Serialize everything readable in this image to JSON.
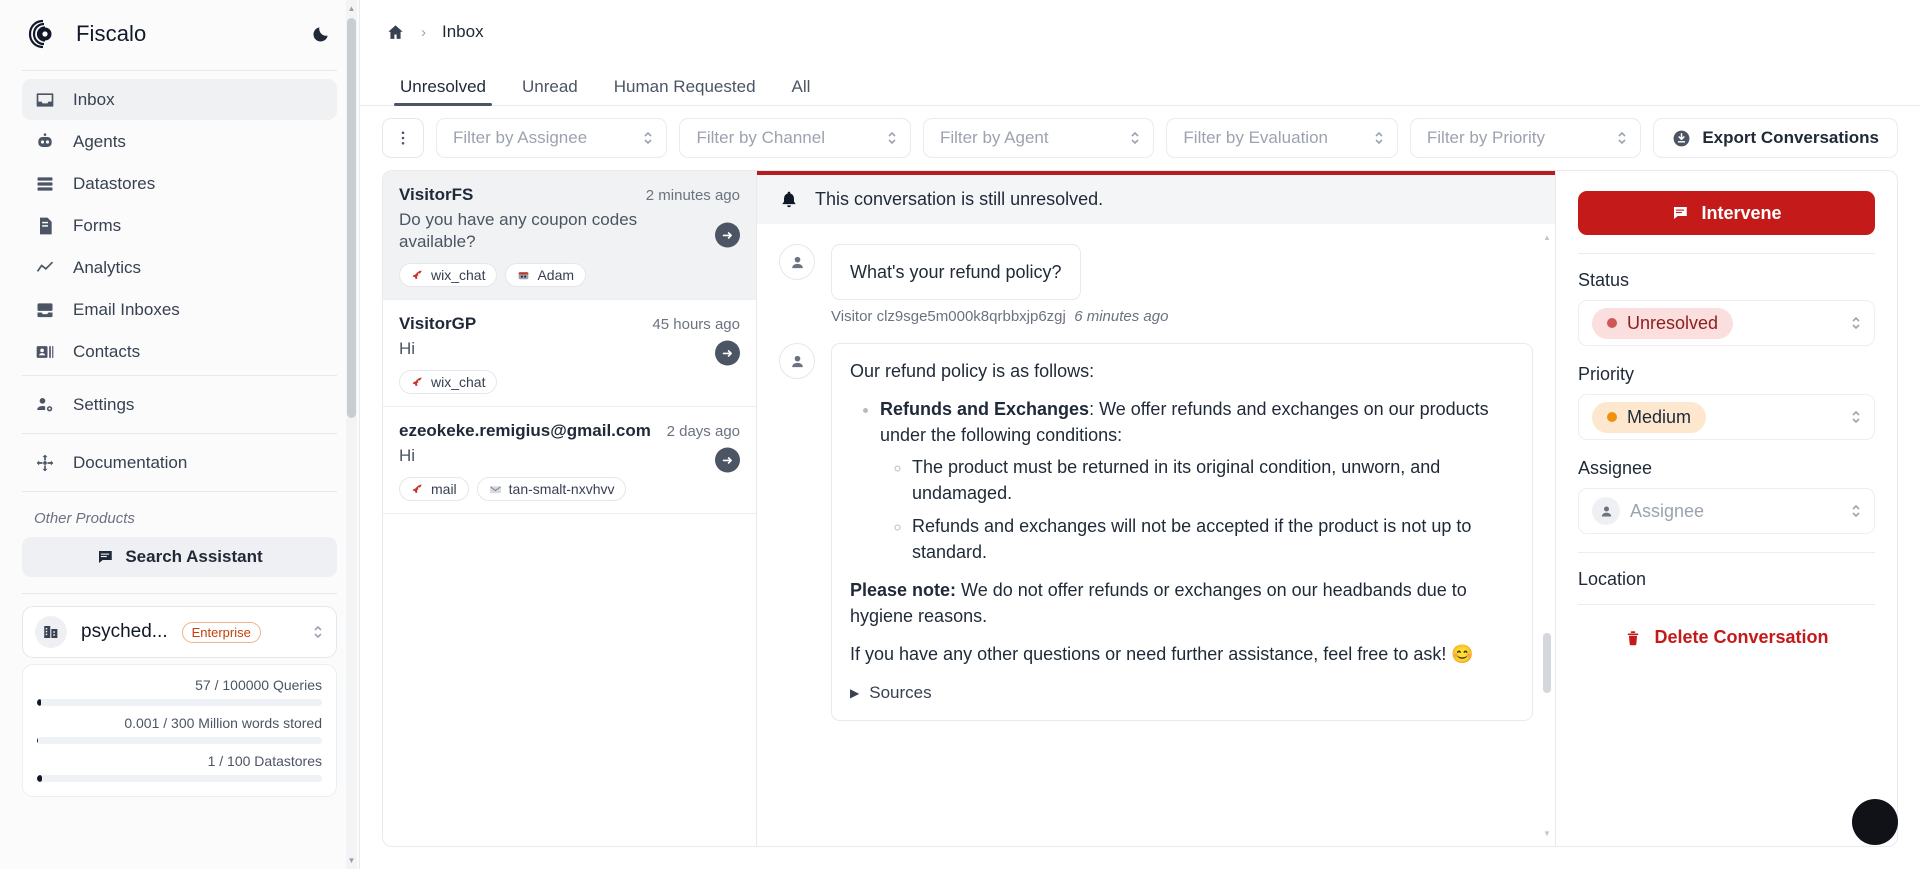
{
  "brand": {
    "name": "Fiscalo",
    "logo_icon": "fiscalo-logo-icon",
    "darkmode_icon": "moon-icon"
  },
  "sidebar": {
    "nav": [
      {
        "label": "Inbox",
        "icon": "inbox-icon",
        "active": true
      },
      {
        "label": "Agents",
        "icon": "robot-icon",
        "active": false
      },
      {
        "label": "Datastores",
        "icon": "database-icon",
        "active": false
      },
      {
        "label": "Forms",
        "icon": "document-icon",
        "active": false
      },
      {
        "label": "Analytics",
        "icon": "chart-line-icon",
        "active": false
      },
      {
        "label": "Email Inboxes",
        "icon": "email-inbox-icon",
        "active": false
      },
      {
        "label": "Contacts",
        "icon": "contact-card-icon",
        "active": false
      }
    ],
    "settings": {
      "label": "Settings",
      "icon": "user-settings-icon"
    },
    "documentation": {
      "label": "Documentation",
      "icon": "move-icon"
    },
    "other_products_title": "Other Products",
    "search_assistant": {
      "label": "Search Assistant",
      "icon": "chat-icon"
    },
    "org": {
      "name": "psyched...",
      "plan_badge": "Enterprise",
      "icon": "building-icon"
    },
    "usage": [
      {
        "label": "57 / 100000 Queries",
        "percent": 0.06
      },
      {
        "label": "0.001 / 300 Million words stored",
        "percent": 0.0
      },
      {
        "label": "1 / 100 Datastores",
        "percent": 1
      }
    ]
  },
  "breadcrumb": {
    "home_icon": "home-icon",
    "separator": "›",
    "current": "Inbox"
  },
  "tabs": [
    {
      "label": "Unresolved",
      "active": true
    },
    {
      "label": "Unread",
      "active": false
    },
    {
      "label": "Human Requested",
      "active": false
    },
    {
      "label": "All",
      "active": false
    }
  ],
  "filters": {
    "kebab_icon": "more-vertical-icon",
    "selects": [
      {
        "placeholder": "Filter by Assignee"
      },
      {
        "placeholder": "Filter by Channel"
      },
      {
        "placeholder": "Filter by Agent"
      },
      {
        "placeholder": "Filter by Evaluation"
      },
      {
        "placeholder": "Filter by Priority"
      }
    ],
    "export": {
      "label": "Export Conversations",
      "icon": "download-circle-icon"
    }
  },
  "conversations": [
    {
      "name": "VisitorFS",
      "time": "2 minutes ago",
      "preview": "Do you have any coupon codes available?",
      "tags": [
        {
          "label": "wix_chat",
          "icon": "rocket-icon"
        },
        {
          "label": "Adam",
          "icon": "robot-icon"
        }
      ],
      "selected": true
    },
    {
      "name": "VisitorGP",
      "time": "45 hours ago",
      "preview": "Hi",
      "tags": [
        {
          "label": "wix_chat",
          "icon": "rocket-icon"
        }
      ],
      "selected": false
    },
    {
      "name": "ezeokeke.remigius@gmail.com",
      "time": "2 days ago",
      "preview": "Hi",
      "tags": [
        {
          "label": "mail",
          "icon": "rocket-icon"
        },
        {
          "label": "tan-smalt-nxvhvv",
          "icon": "mail-icon"
        }
      ],
      "selected": false
    }
  ],
  "thread": {
    "banner": {
      "text": "This conversation is still unresolved.",
      "icon": "bell-icon",
      "accent": "#b91c1c"
    },
    "visitor_message": "What's your refund policy?",
    "visitor_meta_name": "Visitor clz9sge5m000k8qrbbxjp6zgj",
    "visitor_meta_time": "6 minutes ago",
    "reply": {
      "intro": "Our refund policy is as follows:",
      "bullet_bold": "Refunds and Exchanges",
      "bullet_rest": ": We offer refunds and exchanges on our products under the following conditions:",
      "sub_bullets": [
        "The product must be returned in its original condition, unworn, and undamaged.",
        "Refunds and exchanges will not be accepted if the product is not up to standard."
      ],
      "note_bold": "Please note:",
      "note_rest": " We do not offer refunds or exchanges on our headbands due to hygiene reasons.",
      "closing": "If you have any other questions or need further assistance, feel free to ask! 😊",
      "sources_label": "Sources"
    }
  },
  "rightpanel": {
    "intervene": {
      "label": "Intervene",
      "icon": "chat-icon",
      "color": "#c51a1a"
    },
    "status": {
      "label": "Status",
      "value": "Unresolved",
      "dot_color": "#d15757",
      "bg": "#fbdede"
    },
    "priority": {
      "label": "Priority",
      "value": "Medium",
      "dot_color": "#f0900f",
      "bg": "#fde7cf"
    },
    "assignee": {
      "label": "Assignee",
      "placeholder": "Assignee",
      "icon": "user-icon"
    },
    "location": {
      "label": "Location"
    },
    "delete": {
      "label": "Delete Conversation",
      "icon": "trash-icon",
      "color": "#c51a1a"
    }
  },
  "fab": {
    "icon": "chat-widget-fab-icon"
  }
}
